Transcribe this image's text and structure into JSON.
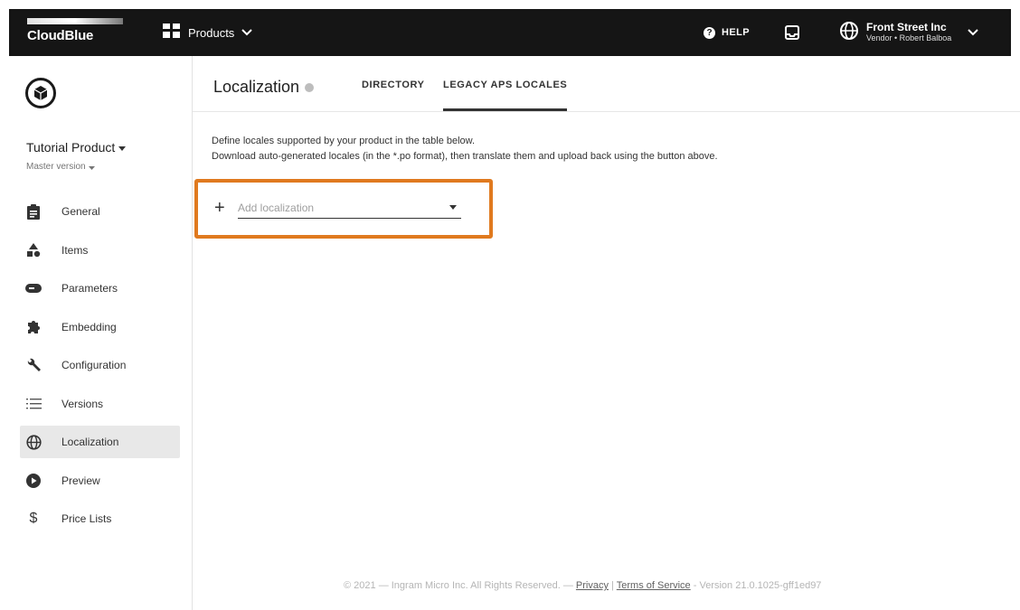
{
  "topbar": {
    "logo_text": "CloudBlue",
    "products_label": "Products",
    "help_label": "HELP",
    "account_name": "Front Street Inc",
    "account_role": "Vendor • Robert Balboa"
  },
  "sidebar": {
    "product_name": "Tutorial Product",
    "product_version": "Master version",
    "items": [
      {
        "label": "General",
        "icon": "clipboard-icon"
      },
      {
        "label": "Items",
        "icon": "shapes-icon"
      },
      {
        "label": "Parameters",
        "icon": "toggle-icon"
      },
      {
        "label": "Embedding",
        "icon": "puzzle-icon"
      },
      {
        "label": "Configuration",
        "icon": "wrench-icon"
      },
      {
        "label": "Versions",
        "icon": "list-icon"
      },
      {
        "label": "Localization",
        "icon": "globe-icon",
        "active": true
      },
      {
        "label": "Preview",
        "icon": "play-icon"
      },
      {
        "label": "Price Lists",
        "icon": "dollar-icon"
      }
    ]
  },
  "main": {
    "title": "Localization",
    "tabs": [
      {
        "label": "DIRECTORY",
        "active": false
      },
      {
        "label": "LEGACY APS LOCALES",
        "active": true
      }
    ],
    "description_line1": "Define locales supported by your product in the table below.",
    "description_line2": "Download auto-generated locales (in the *.po format), then translate them and upload back using the button above.",
    "add_localization": {
      "placeholder": "Add localization",
      "value": ""
    }
  },
  "footer": {
    "copyright": "© 2021 — Ingram Micro Inc. All Rights Reserved. — ",
    "privacy": "Privacy",
    "separator": " | ",
    "terms": "Terms of Service",
    "version": " - Version 21.0.1025-gff1ed97"
  },
  "colors": {
    "topbar_bg": "#151515",
    "highlight": "#e07a1f",
    "active_nav_bg": "#e8e8e8"
  }
}
